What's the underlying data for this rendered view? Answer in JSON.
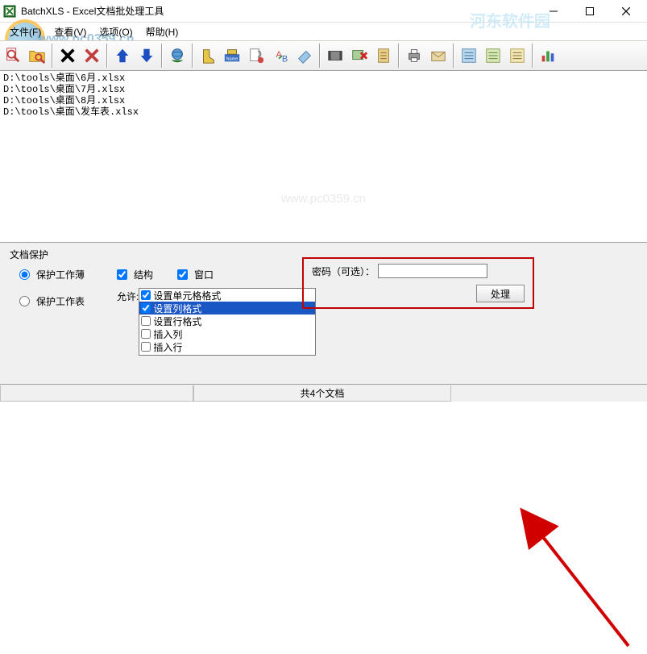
{
  "window": {
    "title": "BatchXLS - Excel文档批处理工具",
    "min_tip": "—",
    "max_tip": "□",
    "close_tip": "×"
  },
  "menu": {
    "file": "文件(F)",
    "view": "查看(V)",
    "options": "选项(O)",
    "help": "帮助(H)"
  },
  "watermark": {
    "site": "www.pc0359.cn",
    "brand": "河东软件园",
    "center": "www.pc0359.cn"
  },
  "files": [
    "D:\\tools\\桌面\\6月.xlsx",
    "D:\\tools\\桌面\\7月.xlsx",
    "D:\\tools\\桌面\\8月.xlsx",
    "D:\\tools\\桌面\\发车表.xlsx"
  ],
  "panel": {
    "section": "文档保护",
    "radio_protect_book": "保护工作薄",
    "radio_protect_sheet": "保护工作表",
    "chk_structure": "结构",
    "chk_window": "窗口",
    "allow_label": "允许:",
    "allow_items": [
      {
        "label": "设置单元格格式",
        "checked": true,
        "selected": false
      },
      {
        "label": "设置列格式",
        "checked": true,
        "selected": true
      },
      {
        "label": "设置行格式",
        "checked": false,
        "selected": false
      },
      {
        "label": "插入列",
        "checked": false,
        "selected": false
      },
      {
        "label": "插入行",
        "checked": false,
        "selected": false
      }
    ],
    "password_label": "密码（可选）：",
    "process_button": "处理"
  },
  "status": {
    "count": "共4个文档"
  }
}
